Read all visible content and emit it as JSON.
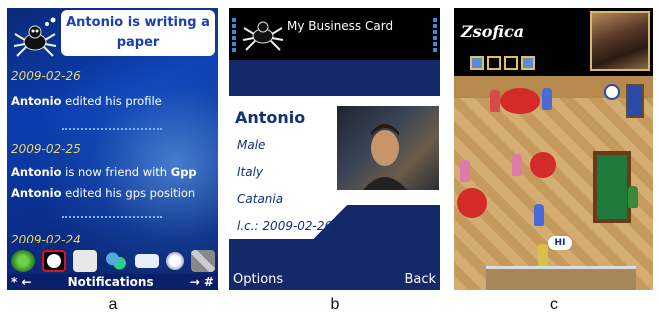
{
  "panel_a": {
    "bubble_text": "Antonio is writing  a paper",
    "entries": [
      {
        "date": "2009-02-26",
        "lines": [
          {
            "name": "Antonio",
            "text": " edited his profile"
          }
        ]
      },
      {
        "date": "2009-02-25",
        "lines": [
          {
            "name": "Antonio",
            "text": " is now friend with ",
            "extra": "Gpp"
          },
          {
            "name": "Antonio",
            "text": " edited his gps position"
          }
        ]
      },
      {
        "date": "2009-02-24"
      }
    ],
    "softkeys": {
      "left": "* ←",
      "center": "Notifications",
      "right": "→ #"
    },
    "icons": [
      "refresh-icon",
      "avatar-icon",
      "contact-card-icon",
      "friends-icon",
      "mail-icon",
      "search-icon",
      "satellite-icon"
    ]
  },
  "panel_b": {
    "title": "My Business Card",
    "name": "Antonio",
    "fields": [
      "Male",
      "Italy",
      "Catania",
      "l.c.: 2009-02-26"
    ],
    "softkeys": {
      "left": "Options",
      "right": "Back"
    }
  },
  "panel_c": {
    "name": "Zsofica",
    "speech": "HI"
  },
  "captions": [
    "a",
    "b",
    "c"
  ]
}
